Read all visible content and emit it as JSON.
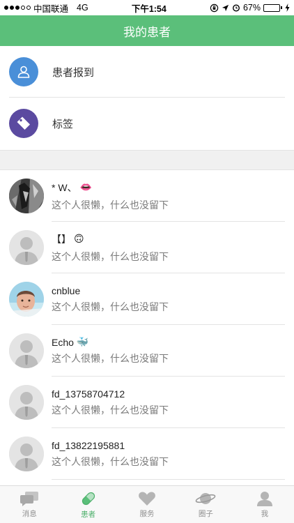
{
  "status_bar": {
    "carrier": "中国联通",
    "network": "4G",
    "time": "下午1:54",
    "battery": "67%",
    "battery_level": 0.67
  },
  "nav": {
    "title": "我的患者"
  },
  "menu": [
    {
      "label": "患者报到",
      "icon": "person-icon",
      "color": "#4a8fd8"
    },
    {
      "label": "标签",
      "icon": "tag-icon",
      "color": "#5b4aa0"
    }
  ],
  "patients": [
    {
      "name": "* W、",
      "emoji": "👄",
      "desc": "这个人很懒，什么也没留下",
      "avatar": "photo-bw"
    },
    {
      "name": "【】",
      "emoji": "🙃",
      "desc": "这个人很懒，什么也没留下",
      "avatar": "default"
    },
    {
      "name": "cnblue",
      "emoji": "",
      "desc": "这个人很懒，什么也没留下",
      "avatar": "photo-color"
    },
    {
      "name": "Echo",
      "emoji": "🐳",
      "desc": "这个人很懒，什么也没留下",
      "avatar": "default"
    },
    {
      "name": "fd_13758704712",
      "emoji": "",
      "desc": "这个人很懒，什么也没留下",
      "avatar": "default"
    },
    {
      "name": "fd_13822195881",
      "emoji": "",
      "desc": "这个人很懒，什么也没留下",
      "avatar": "default"
    }
  ],
  "tabs": [
    {
      "label": "消息",
      "icon": "message-icon",
      "active": false
    },
    {
      "label": "患者",
      "icon": "pill-icon",
      "active": true
    },
    {
      "label": "服务",
      "icon": "heart-icon",
      "active": false
    },
    {
      "label": "圈子",
      "icon": "planet-icon",
      "active": false
    },
    {
      "label": "我",
      "icon": "user-icon",
      "active": false
    }
  ],
  "colors": {
    "brand": "#5bbf7a",
    "tab_active": "#4caf6a",
    "tab_inactive": "#9b9b9b"
  }
}
